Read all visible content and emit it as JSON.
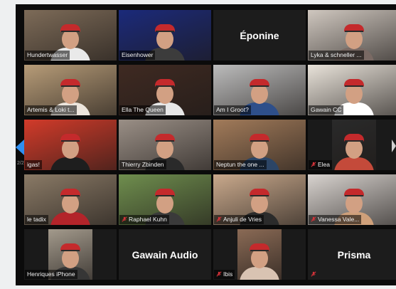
{
  "window": {
    "page_indicator": "2/2"
  },
  "colors": {
    "active_speaker": "#c9e26a",
    "nav_arrow": "#2f8ff1",
    "muted_mic": "#d6333a",
    "tile_bg": "#1c1c1c"
  },
  "tiles": [
    {
      "label": "Hundertwasser",
      "muted": false,
      "video": true,
      "bg": "#7d6b58",
      "shirt": "#e9e9e9"
    },
    {
      "label": "Eisenhower",
      "muted": false,
      "video": true,
      "bg": "#1b2a7a",
      "shirt": "#3c3c3c"
    },
    {
      "label": "",
      "display_name": "Éponine",
      "muted": false,
      "video": false
    },
    {
      "label": "Lyka & schneller ...",
      "muted": false,
      "video": true,
      "bg": "#cfc7bf",
      "shirt": "#7a6a64"
    },
    {
      "label": "Artemis & Loki t...",
      "muted": false,
      "video": true,
      "bg": "#b79c78",
      "shirt": "#ece5dc"
    },
    {
      "label": "Ella The Queen",
      "muted": false,
      "video": true,
      "active": true,
      "bg": "#3f2a22",
      "shirt": "#e7e7e7"
    },
    {
      "label": "Am I Groot?",
      "muted": false,
      "video": true,
      "bg": "#bcbcbc",
      "shirt": "#2e4f8a"
    },
    {
      "label": "Gawain CC",
      "muted": false,
      "video": true,
      "bg": "#e9e3da",
      "shirt": "#ffffff"
    },
    {
      "label": "igas!",
      "muted": false,
      "video": true,
      "bg": "#d23b2a",
      "shirt": "#1e1e1e"
    },
    {
      "label": "Thierry Zbinden",
      "muted": false,
      "video": true,
      "bg": "#9a8f86",
      "shirt": "#2a2a2a"
    },
    {
      "label": "Neptun the one ...",
      "muted": false,
      "video": true,
      "bg": "#a27b5a",
      "shirt": "#2c4566"
    },
    {
      "label": "Elea",
      "muted": true,
      "video": true,
      "bg": "#2a2a2a",
      "shirt": "#c44a3a",
      "small": true
    },
    {
      "label": "le tadix",
      "muted": false,
      "video": true,
      "bg": "#8a7a66",
      "shirt": "#b3242a"
    },
    {
      "label": "Raphael Kuhn",
      "muted": true,
      "video": true,
      "bg": "#6f8e4e",
      "shirt": "#3a3a3a"
    },
    {
      "label": "Anjuli de Vries",
      "muted": true,
      "video": true,
      "bg": "#c9a98c",
      "shirt": "#2b2b2b"
    },
    {
      "label": "Vanessa Vale...",
      "muted": true,
      "video": true,
      "bg": "#d8d3cf",
      "shirt": "#cfa07a"
    },
    {
      "label": "Henriques iPhone",
      "muted": false,
      "video": true,
      "bg": "#a39a8c",
      "shirt": "#363636",
      "small": true
    },
    {
      "label": "",
      "display_name": "Gawain Audio",
      "muted": false,
      "video": false
    },
    {
      "label": "Ibis",
      "muted": true,
      "video": true,
      "bg": "#8a6a55",
      "shirt": "#d9c3b2",
      "small": true
    },
    {
      "label": "",
      "display_name": "Prisma",
      "muted": true,
      "video": false
    }
  ]
}
